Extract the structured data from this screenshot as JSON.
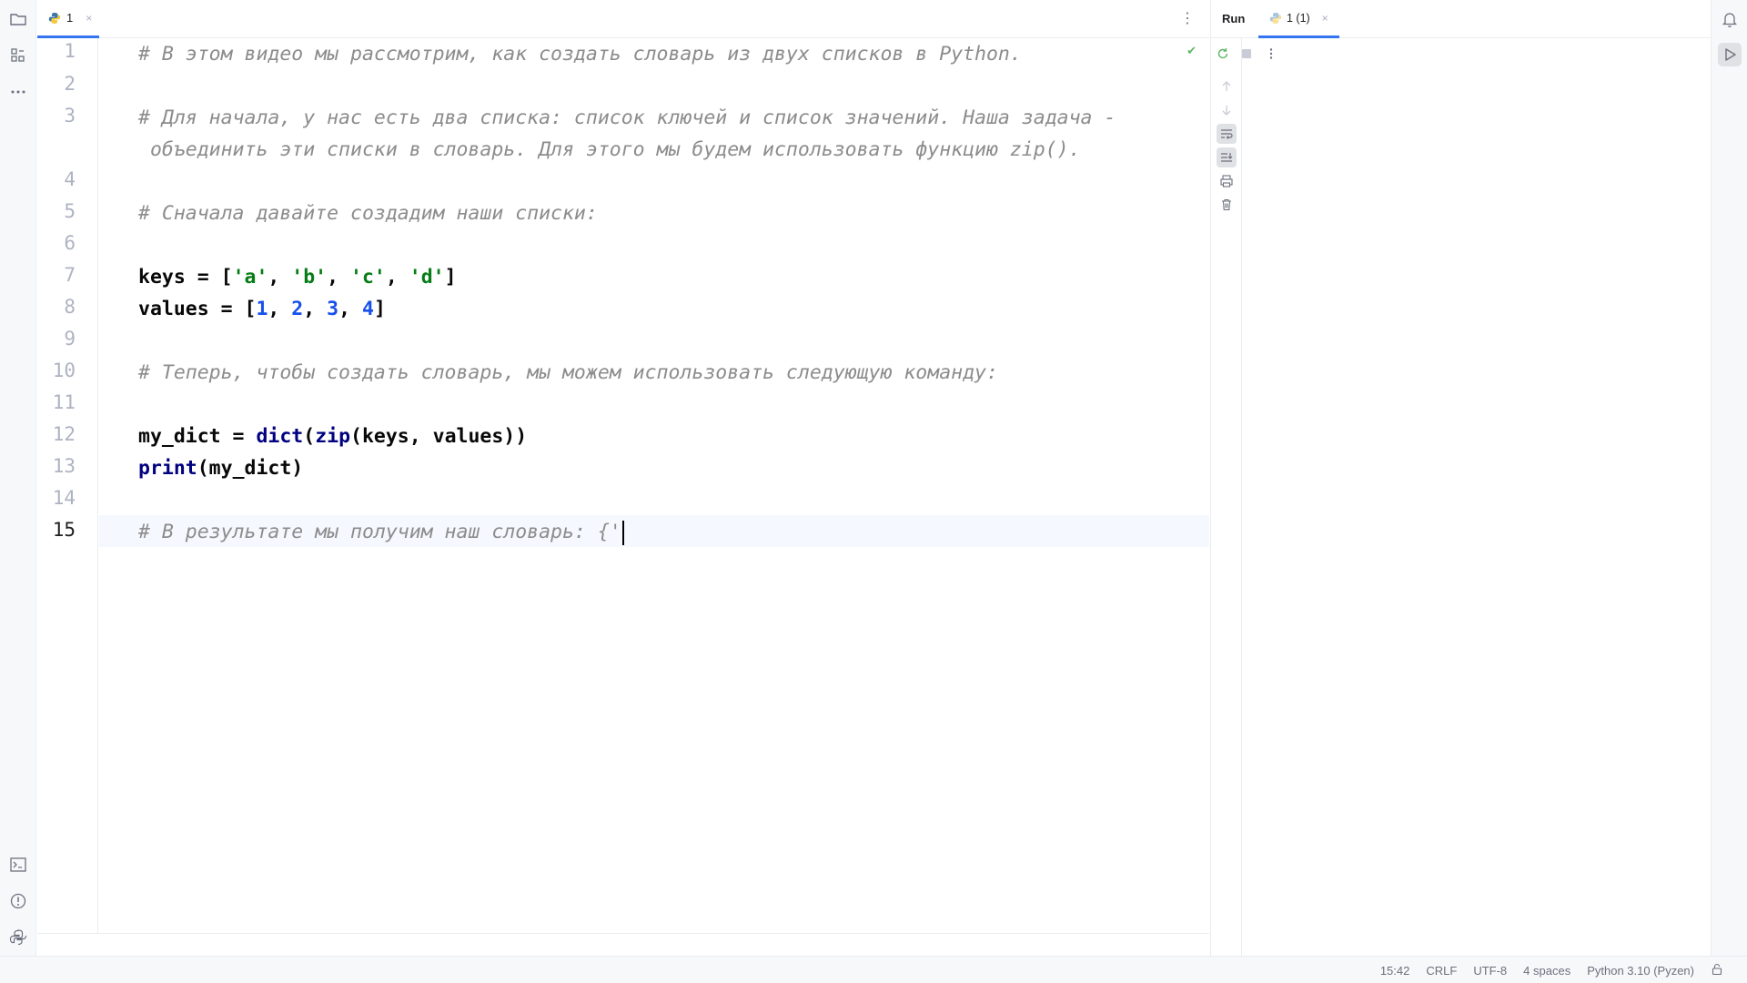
{
  "editor": {
    "tab": {
      "label": "1",
      "close": "×"
    },
    "menu_glyph": "⋮",
    "inspection_glyph": "✔",
    "line_numbers": [
      "1",
      "2",
      "3",
      "",
      "4",
      "5",
      "6",
      "7",
      "8",
      "9",
      "10",
      "11",
      "12",
      "13",
      "14",
      "15"
    ],
    "lines": {
      "l1": "# В этом видео мы рассмотрим, как создать словарь из двух списков в Python.",
      "l3a": "# Для начала, у нас есть два списка: список ключей и список значений. Наша задача -",
      "l3b": " объединить эти списки в словарь. Для этого мы будем использовать функцию zip().",
      "l5": "# Сначала давайте создадим наши списки:",
      "l7": {
        "t1": "keys = [",
        "t2": "'a'",
        "t3": ", ",
        "t4": "'b'",
        "t5": ", ",
        "t6": "'c'",
        "t7": ", ",
        "t8": "'d'",
        "t9": "]"
      },
      "l8": {
        "t1": "values = [",
        "t2": "1",
        "t3": ", ",
        "t4": "2",
        "t5": ", ",
        "t6": "3",
        "t7": ", ",
        "t8": "4",
        "t9": "]"
      },
      "l10": "# Теперь, чтобы создать словарь, мы можем использовать следующую команду:",
      "l12": {
        "t1": "my_dict = ",
        "t2": "dict",
        "t3": "(",
        "t4": "zip",
        "t5": "(keys, values))"
      },
      "l13": {
        "t1": "print",
        "t2": "(my_dict)"
      },
      "l15": "# В результате мы получим наш словарь: {'"
    }
  },
  "run": {
    "title": "Run",
    "tab": {
      "label": "1 (1)",
      "close": "×"
    },
    "more_glyph": "⋮"
  },
  "status_bar": {
    "position": "15:42",
    "line_separator": "CRLF",
    "encoding": "UTF-8",
    "indent": "4 spaces",
    "interpreter": "Python 3.10 (Pyzen)"
  },
  "colors": {
    "comment": "#8c8c8c",
    "string": "#067d17",
    "number": "#1750eb",
    "builtin": "#000080",
    "accent": "#3574f0"
  },
  "icons": {
    "left_top": [
      "folder-icon",
      "structure-icon",
      "more-icon"
    ],
    "left_bottom": [
      "terminal-icon",
      "problems-icon",
      "python-console-icon"
    ],
    "run_toolbar": [
      "rerun-icon",
      "stop-icon",
      "more-vertical-icon",
      "arrow-up-icon",
      "arrow-down-icon",
      "soft-wrap-icon",
      "scroll-to-end-icon",
      "print-icon",
      "trash-icon"
    ],
    "right": [
      "notifications-icon",
      "run-play-icon"
    ],
    "status": [
      "lock-icon"
    ]
  }
}
